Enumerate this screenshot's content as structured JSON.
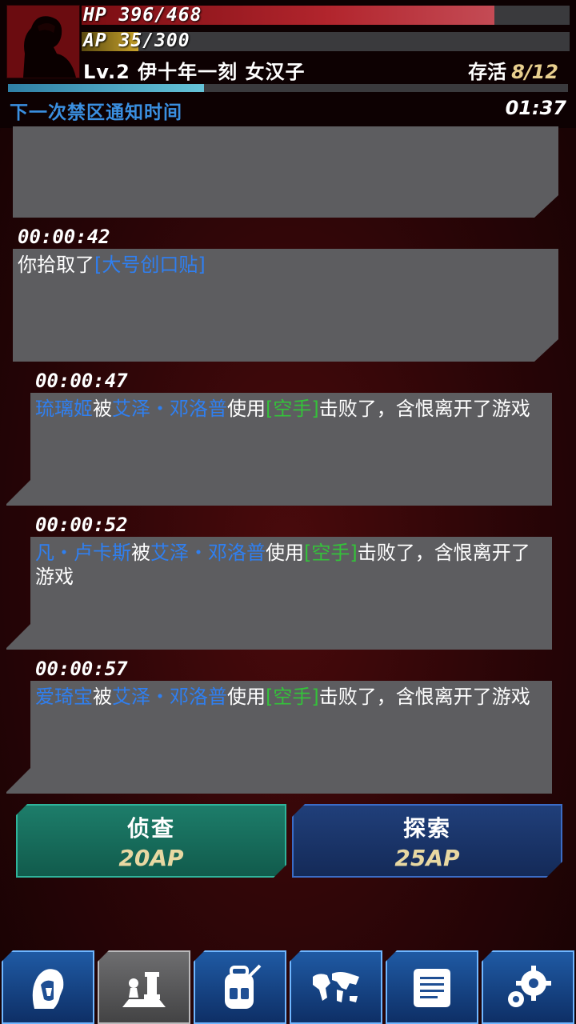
{
  "header": {
    "hp_text": "HP 396/468",
    "hp_value": 396,
    "hp_max": 468,
    "ap_text": "AP 35/300",
    "ap_value": 35,
    "ap_max": 300,
    "player_info": "Lv.2 伊十年一刻 女汉子",
    "survive_label": "存活",
    "survive_count": "8/12",
    "timer_progress": 0.35,
    "notice_label": "下一次禁区通知时间",
    "notice_time": "01:37"
  },
  "log": [
    {
      "timestamp": "00:00:42",
      "parts": [
        {
          "text": "你拾取了",
          "color": "white"
        },
        {
          "text": "[大号创口贴]",
          "color": "blue"
        }
      ]
    },
    {
      "timestamp": "00:00:47",
      "parts": [
        {
          "text": "琉璃姬",
          "color": "blue"
        },
        {
          "text": "被",
          "color": "white"
        },
        {
          "text": "艾泽・邓洛普",
          "color": "blue"
        },
        {
          "text": "使用",
          "color": "white"
        },
        {
          "text": "[空手]",
          "color": "green"
        },
        {
          "text": "击败了，含恨离开了游戏",
          "color": "white"
        }
      ]
    },
    {
      "timestamp": "00:00:52",
      "parts": [
        {
          "text": "凡・卢卡斯",
          "color": "blue"
        },
        {
          "text": "被",
          "color": "white"
        },
        {
          "text": "艾泽・邓洛普",
          "color": "blue"
        },
        {
          "text": "使用",
          "color": "white"
        },
        {
          "text": "[空手]",
          "color": "green"
        },
        {
          "text": "击败了，含恨离开了游戏",
          "color": "white"
        }
      ]
    },
    {
      "timestamp": "00:00:57",
      "parts": [
        {
          "text": "爱琦宝",
          "color": "blue"
        },
        {
          "text": "被",
          "color": "white"
        },
        {
          "text": "艾泽・邓洛普",
          "color": "blue"
        },
        {
          "text": "使用",
          "color": "white"
        },
        {
          "text": "[空手]",
          "color": "green"
        },
        {
          "text": "击败了，含恨离开了游戏",
          "color": "white"
        }
      ]
    }
  ],
  "actions": {
    "investigate_label": "侦查",
    "investigate_cost": "20AP",
    "explore_label": "探索",
    "explore_cost": "25AP"
  },
  "nav": [
    {
      "name": "character",
      "icon": "hooded-head-icon",
      "active": false
    },
    {
      "name": "battle",
      "icon": "chess-pieces-icon",
      "active": true
    },
    {
      "name": "inventory",
      "icon": "backpack-icon",
      "active": false
    },
    {
      "name": "map",
      "icon": "world-map-icon",
      "active": false
    },
    {
      "name": "log",
      "icon": "scroll-icon",
      "active": false
    },
    {
      "name": "settings",
      "icon": "gears-icon",
      "active": false
    }
  ]
}
